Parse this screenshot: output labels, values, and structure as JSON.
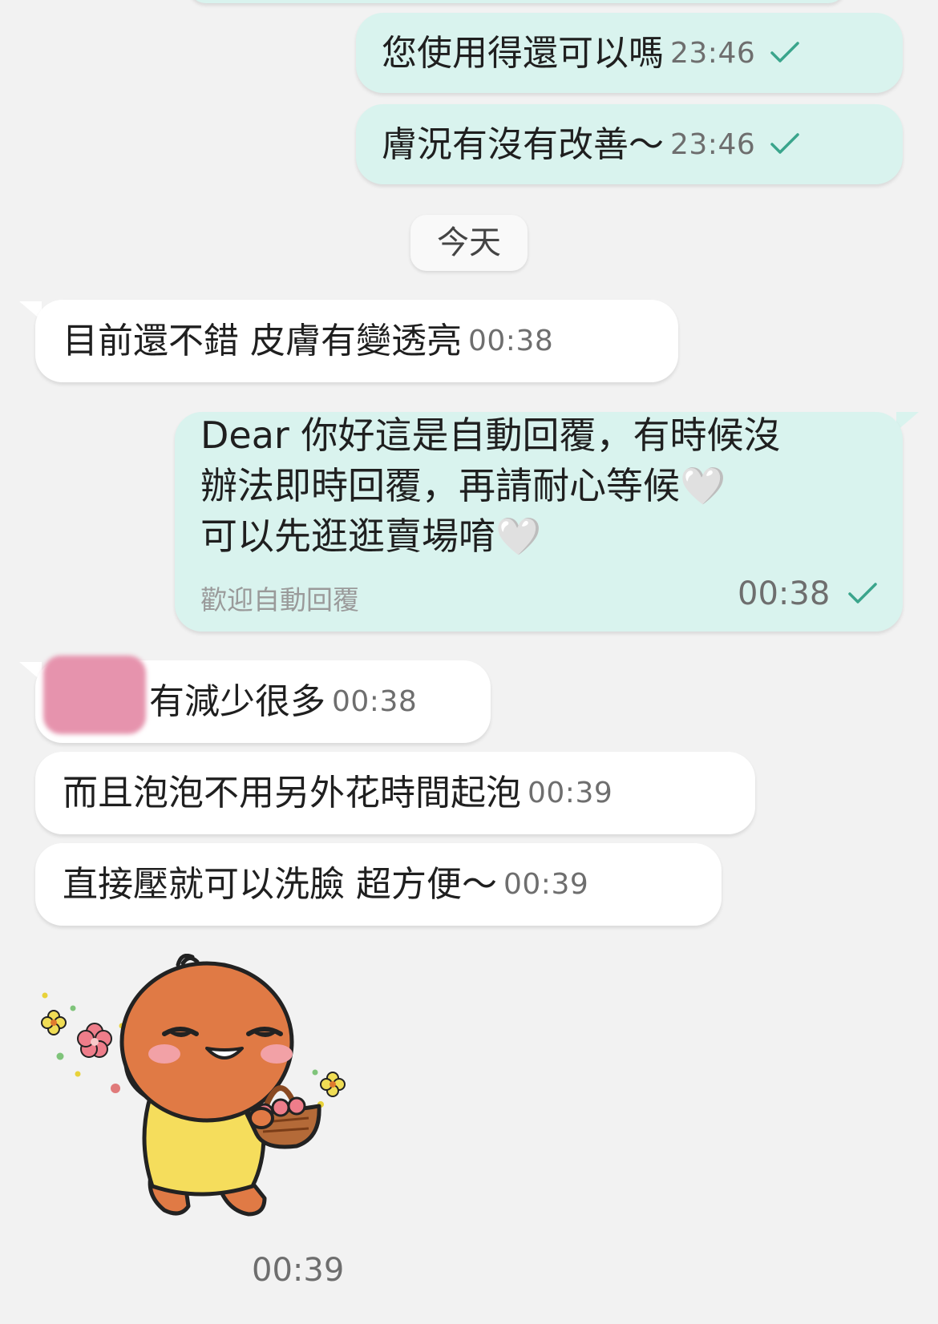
{
  "colors": {
    "background": "#f2f2f2",
    "outgoing_bubble": "#d9f3ee",
    "incoming_bubble": "#ffffff",
    "read_check": "#3aa58c",
    "redaction": "#e693ad"
  },
  "messages_before": [
    {
      "direction": "outgoing",
      "text": "您使用得還可以嗎",
      "time": "23:46",
      "status_icon": "read-check-icon"
    },
    {
      "direction": "outgoing",
      "text": "膚況有沒有改善～",
      "time": "23:46",
      "status_icon": "read-check-icon"
    }
  ],
  "date_separator": "今天",
  "messages_today": {
    "m1": {
      "direction": "incoming",
      "text": "目前還不錯 皮膚有變透亮",
      "time": "00:38"
    },
    "auto_reply": {
      "direction": "outgoing",
      "lines": [
        "Dear 你好這是自動回覆，有時候沒",
        "辦法即時回覆，再請耐心等候🤍",
        "可以先逛逛賣場唷🤍"
      ],
      "label": "歡迎自動回覆",
      "time": "00:38",
      "status_icon": "read-check-icon"
    },
    "m3": {
      "direction": "incoming",
      "text": "有減少很多",
      "time": "00:38",
      "redacted_prefix": true
    },
    "m4": {
      "direction": "incoming",
      "text": "而且泡泡不用另外花時間起泡",
      "time": "00:39"
    },
    "m5": {
      "direction": "incoming",
      "text": "直接壓就可以洗臉 超方便～",
      "time": "00:39"
    },
    "sticker": {
      "direction": "incoming",
      "description_icon": "orange-character-sticker",
      "time": "00:39"
    }
  }
}
